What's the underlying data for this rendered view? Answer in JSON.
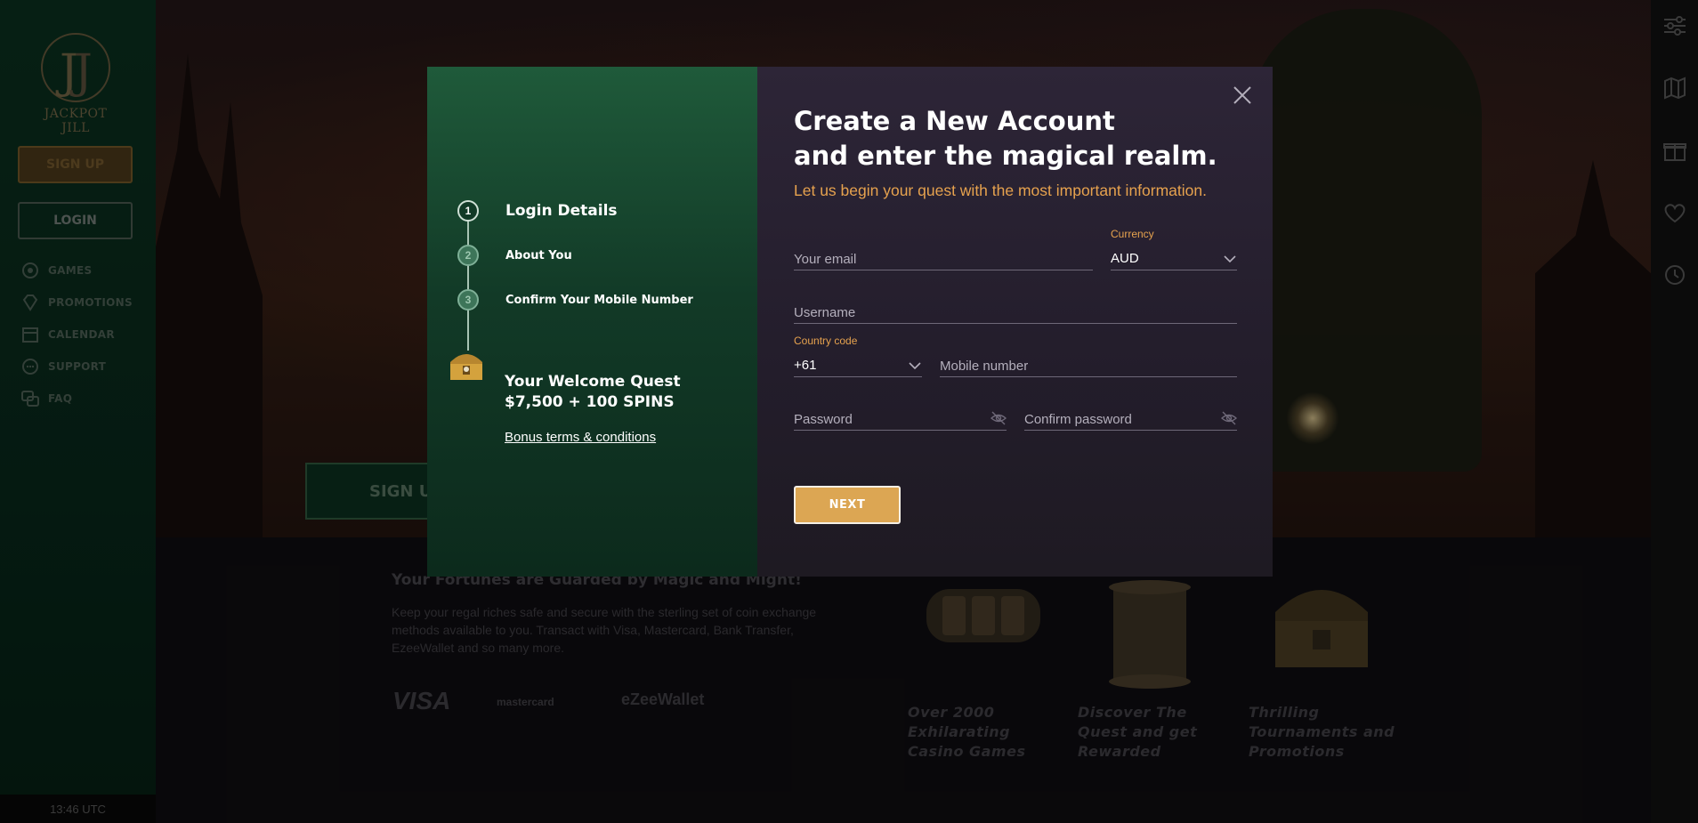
{
  "brand": {
    "logo_text": "JACKPOT JILL",
    "accent": "#dca653",
    "green": "#0c3a25"
  },
  "sidebar": {
    "signup_label": "SIGN UP",
    "login_label": "LOGIN",
    "nav": [
      {
        "label": "GAMES",
        "icon": "games-icon"
      },
      {
        "label": "PROMOTIONS",
        "icon": "diamond-icon"
      },
      {
        "label": "CALENDAR",
        "icon": "calendar-icon"
      },
      {
        "label": "SUPPORT",
        "icon": "support-icon"
      },
      {
        "label": "FAQ",
        "icon": "faq-icon"
      }
    ],
    "clock": "13:46 UTC"
  },
  "hero": {
    "cta_label": "SIGN UP"
  },
  "lower": {
    "title": "Your Fortunes are Guarded by Magic and Might!",
    "text": "Keep your regal riches safe and secure with the sterling set of coin exchange methods available to you. Transact with Visa, Mastercard, Bank Transfer, EzeeWallet and so many more.",
    "payments": [
      "VISA",
      "mastercard",
      "eZeeWallet"
    ],
    "features": [
      "Over 2000 Exhilarating Casino Games",
      "Discover The Quest and get Rewarded",
      "Thrilling Tournaments and Promotions"
    ]
  },
  "right_rail": {
    "icons": [
      "filter-icon",
      "map-icon",
      "gift-icon",
      "heart-icon",
      "history-icon"
    ]
  },
  "modal": {
    "steps": [
      {
        "num": "1",
        "label": "Login Details"
      },
      {
        "num": "2",
        "label": "About You"
      },
      {
        "num": "3",
        "label": "Confirm Your Mobile Number"
      }
    ],
    "quest_line1": "Your Welcome Quest",
    "quest_line2": "$7,500 + 100 SPINS",
    "bonus_link": "Bonus terms & conditions",
    "title_line1": "Create a New Account",
    "title_line2": "and enter the magical realm.",
    "subtitle": "Let us begin your quest with the most important information.",
    "email_placeholder": "Your email",
    "currency_label": "Currency",
    "currency_value": "AUD",
    "username_placeholder": "Username",
    "country_code_label": "Country code",
    "country_code_value": "+61",
    "mobile_placeholder": "Mobile number",
    "password_placeholder": "Password",
    "confirm_password_placeholder": "Confirm password",
    "next_label": "NEXT"
  }
}
